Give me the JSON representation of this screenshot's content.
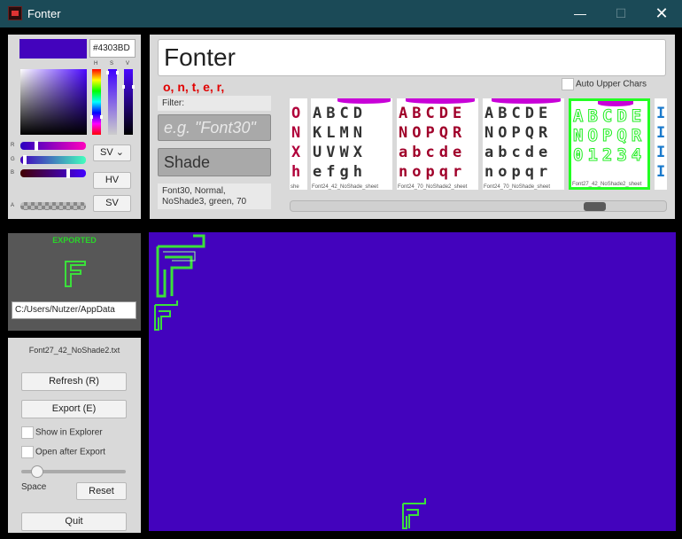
{
  "window": {
    "title": "Fonter",
    "minimize": "—",
    "maximize": "☐",
    "close": "✕"
  },
  "color_picker": {
    "hex": "#4303BD",
    "swatch_color": "#4303bd",
    "labels": {
      "h": "H",
      "s": "S",
      "v": "V",
      "r": "R",
      "g": "G",
      "b": "B",
      "a": "A"
    },
    "mode": "SV",
    "hv_button": "HV",
    "sv_button": "SV"
  },
  "preview": {
    "text": "Fonter",
    "recent_chars": "o, n, t, e, r,",
    "auto_upper_label": "Auto Upper Chars",
    "filter_label": "Filter:",
    "filter_placeholder": "e.g. \"Font30\"",
    "shade_label": "Shade",
    "font_info_line1": "Font30, Normal,",
    "font_info_line2": "NoShade3, green, 70"
  },
  "sheets": [
    {
      "caption": "she",
      "color": "#b0003a"
    },
    {
      "caption": "Font24_42_NoShade_sheet",
      "color": "#333333"
    },
    {
      "caption": "Font24_70_NoShade2_sheet",
      "color": "#a0002a"
    },
    {
      "caption": "Font24_70_NoShade_sheet",
      "color": "#333333"
    },
    {
      "caption": "Font27_42_NoShade2_sheet",
      "color": "#ffffff"
    },
    {
      "caption": "",
      "color": "#1a7acc"
    }
  ],
  "export": {
    "status": "EXPORTED",
    "path": "C:/Users/Nutzer/AppData"
  },
  "controls": {
    "file_name": "Font27_42_NoShade2.txt",
    "refresh": "Refresh (R)",
    "export": "Export (E)",
    "show_in_explorer": "Show in Explorer",
    "open_after_export": "Open after Export",
    "space_label": "Space",
    "reset": "Reset",
    "quit": "Quit"
  },
  "canvas_color": "#4303bd",
  "glyph_color": "#3be03b"
}
